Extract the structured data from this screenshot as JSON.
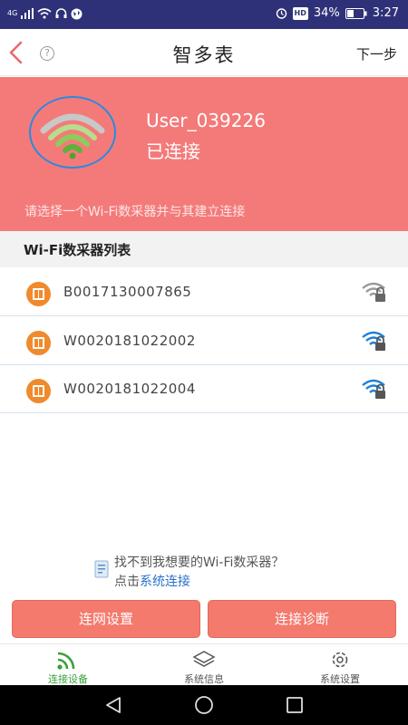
{
  "status_bar": {
    "left_icons": [
      "4g-signal-icon",
      "signal-bars-icon",
      "wifi-icon",
      "headset-icon",
      "globe-icon"
    ],
    "right_icons": [
      "alarm-icon",
      "hd-icon",
      "battery-icon"
    ],
    "network_label": "4G",
    "hd_label": "HD",
    "battery": "34%",
    "time": "3:27"
  },
  "header": {
    "title": "智多表",
    "next_label": "下一步",
    "help_label": "?"
  },
  "hero": {
    "user": "User_039226",
    "status": "已连接",
    "hint": "请选择一个Wi-Fi数采器并与其建立连接",
    "colors": {
      "background": "#f47a7a",
      "ring": "#2a8ae0",
      "wifi_top": "#c8c8c8",
      "wifi_bottom": "#6cc04a"
    }
  },
  "device_list": {
    "header": "Wi-Fi数采器列表",
    "items": [
      {
        "id": "B0017130007865",
        "signal_icon": "wifi-gray-icon"
      },
      {
        "id": "W0020181022002",
        "signal_icon": "wifi-blue-icon"
      },
      {
        "id": "W0020181022004",
        "signal_icon": "wifi-blue-icon"
      }
    ]
  },
  "help": {
    "line1": "找不到我想要的Wi-Fi数采器？",
    "line2_prefix": "点击",
    "line2_link": "系统连接"
  },
  "actions": {
    "network_settings": "连网设置",
    "diagnose": "连接诊断"
  },
  "tabs": [
    {
      "label": "连接设备",
      "icon": "wifi-signal-icon",
      "active": true
    },
    {
      "label": "系统信息",
      "icon": "layers-icon",
      "active": false
    },
    {
      "label": "系统设置",
      "icon": "gear-icon",
      "active": false
    }
  ],
  "accent_colors": {
    "primary": "#f47a7a",
    "tab_active": "#3aa13a",
    "link": "#2a6fc9",
    "device_icon": "#f08a2c"
  }
}
